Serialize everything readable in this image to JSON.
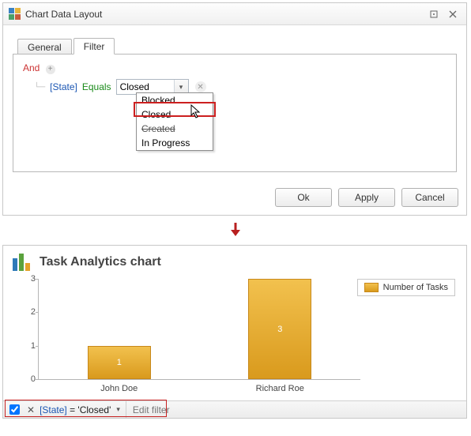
{
  "dialog": {
    "title": "Chart Data Layout",
    "tabs": {
      "general": "General",
      "filter": "Filter"
    },
    "filter": {
      "root_op": "And",
      "condition": {
        "field": "[State]",
        "operator": "Equals",
        "value": "Closed"
      },
      "dropdown_options": [
        "Blocked",
        "Closed",
        "Created",
        "In Progress"
      ],
      "dropdown_highlight_index": 1
    },
    "buttons": {
      "ok": "Ok",
      "apply": "Apply",
      "cancel": "Cancel"
    }
  },
  "chart": {
    "title": "Task Analytics chart",
    "legend": "Number of Tasks",
    "filterbar": {
      "expression_field": "[State]",
      "expression_rest": " = 'Closed'",
      "edit_label": "Edit filter",
      "checked": true
    }
  },
  "chart_data": {
    "type": "bar",
    "categories": [
      "John Doe",
      "Richard Roe"
    ],
    "values": [
      1,
      3
    ],
    "series_name": "Number of Tasks",
    "ylim": [
      0,
      3
    ],
    "yticks": [
      0,
      1,
      2,
      3
    ],
    "xlabel": "",
    "ylabel": "",
    "title": "Task Analytics chart"
  }
}
